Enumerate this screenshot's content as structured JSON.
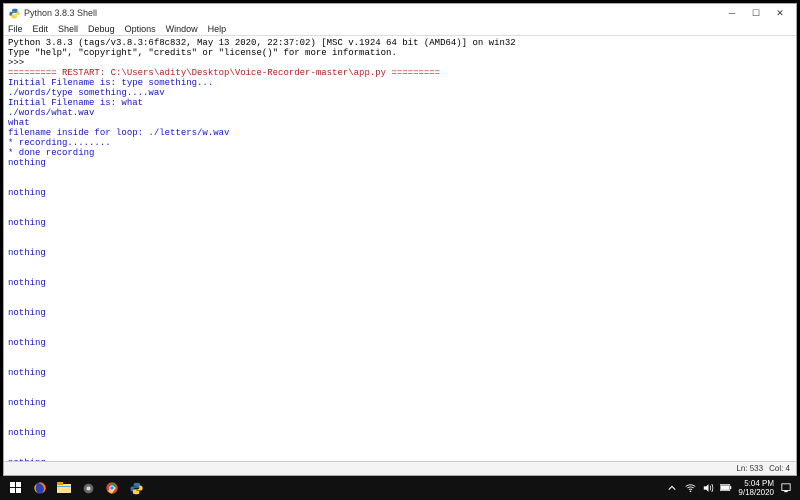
{
  "window": {
    "title": "Python 3.8.3 Shell",
    "menu": [
      "File",
      "Edit",
      "Shell",
      "Debug",
      "Options",
      "Window",
      "Help"
    ],
    "status": {
      "line": "Ln: 533",
      "col": "Col: 4"
    }
  },
  "console": {
    "lines": [
      {
        "text": "Python 3.8.3 (tags/v3.8.3:6f8c832, May 13 2020, 22:37:02) [MSC v.1924 64 bit (AMD64)] on win32",
        "cls": ""
      },
      {
        "text": "Type \"help\", \"copyright\", \"credits\" or \"license()\" for more information.",
        "cls": ""
      },
      {
        "text": ">>> ",
        "cls": ""
      },
      {
        "text": "========= RESTART: C:\\Users\\adity\\Desktop\\Voice-Recorder-master\\app.py =========",
        "cls": "red"
      },
      {
        "text": "Initial Filename is: type something...",
        "cls": "blue"
      },
      {
        "text": "./words/type something....wav",
        "cls": "blue"
      },
      {
        "text": "Initial Filename is: what",
        "cls": "blue"
      },
      {
        "text": "./words/what.wav",
        "cls": "blue"
      },
      {
        "text": "what",
        "cls": "blue"
      },
      {
        "text": "filename inside for loop: ./letters/w.wav",
        "cls": "blue"
      },
      {
        "text": "* recording........",
        "cls": "blue"
      },
      {
        "text": "* done recording",
        "cls": "blue"
      },
      {
        "text": "nothing",
        "cls": "blue"
      },
      {
        "text": "",
        "cls": ""
      },
      {
        "text": "",
        "cls": ""
      },
      {
        "text": "nothing",
        "cls": "blue"
      },
      {
        "text": "",
        "cls": ""
      },
      {
        "text": "",
        "cls": ""
      },
      {
        "text": "nothing",
        "cls": "blue"
      },
      {
        "text": "",
        "cls": ""
      },
      {
        "text": "",
        "cls": ""
      },
      {
        "text": "nothing",
        "cls": "blue"
      },
      {
        "text": "",
        "cls": ""
      },
      {
        "text": "",
        "cls": ""
      },
      {
        "text": "nothing",
        "cls": "blue"
      },
      {
        "text": "",
        "cls": ""
      },
      {
        "text": "",
        "cls": ""
      },
      {
        "text": "nothing",
        "cls": "blue"
      },
      {
        "text": "",
        "cls": ""
      },
      {
        "text": "",
        "cls": ""
      },
      {
        "text": "nothing",
        "cls": "blue"
      },
      {
        "text": "",
        "cls": ""
      },
      {
        "text": "",
        "cls": ""
      },
      {
        "text": "nothing",
        "cls": "blue"
      },
      {
        "text": "",
        "cls": ""
      },
      {
        "text": "",
        "cls": ""
      },
      {
        "text": "nothing",
        "cls": "blue"
      },
      {
        "text": "",
        "cls": ""
      },
      {
        "text": "",
        "cls": ""
      },
      {
        "text": "nothing",
        "cls": "blue"
      },
      {
        "text": "",
        "cls": ""
      },
      {
        "text": "",
        "cls": ""
      },
      {
        "text": "nothing",
        "cls": "blue"
      }
    ]
  },
  "taskbar": {
    "time": "5:04 PM",
    "date": "9/18/2020"
  }
}
